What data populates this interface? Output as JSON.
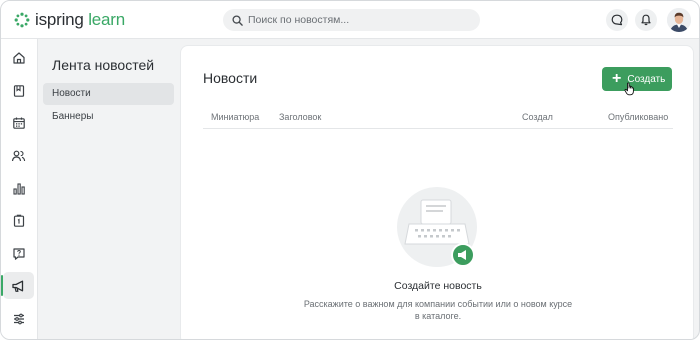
{
  "brand": {
    "name_part1": "ispring",
    "name_part2": "learn",
    "accent": "#3aa866"
  },
  "search": {
    "placeholder": "Поиск по новостям..."
  },
  "rail_icons": [
    "home-icon",
    "book-icon",
    "calendar-icon",
    "users-icon",
    "bar-chart-icon",
    "clipboard-icon",
    "help-chat-icon",
    "megaphone-icon",
    "settings-sliders-icon"
  ],
  "sidebar": {
    "title": "Лента новостей",
    "items": [
      {
        "label": "Новости",
        "active": true
      },
      {
        "label": "Баннеры",
        "active": false
      }
    ]
  },
  "main": {
    "title": "Новости",
    "create_label": "Создать",
    "columns": [
      "Миниатюра",
      "Заголовок",
      "Создал",
      "Опубликовано"
    ],
    "empty": {
      "title": "Создайте новость",
      "description": "Расскажите о важном для компании событии или о новом курсе в каталоге."
    }
  },
  "colors": {
    "primary_button": "#3c9d5e",
    "background": "#f2f3f4"
  }
}
